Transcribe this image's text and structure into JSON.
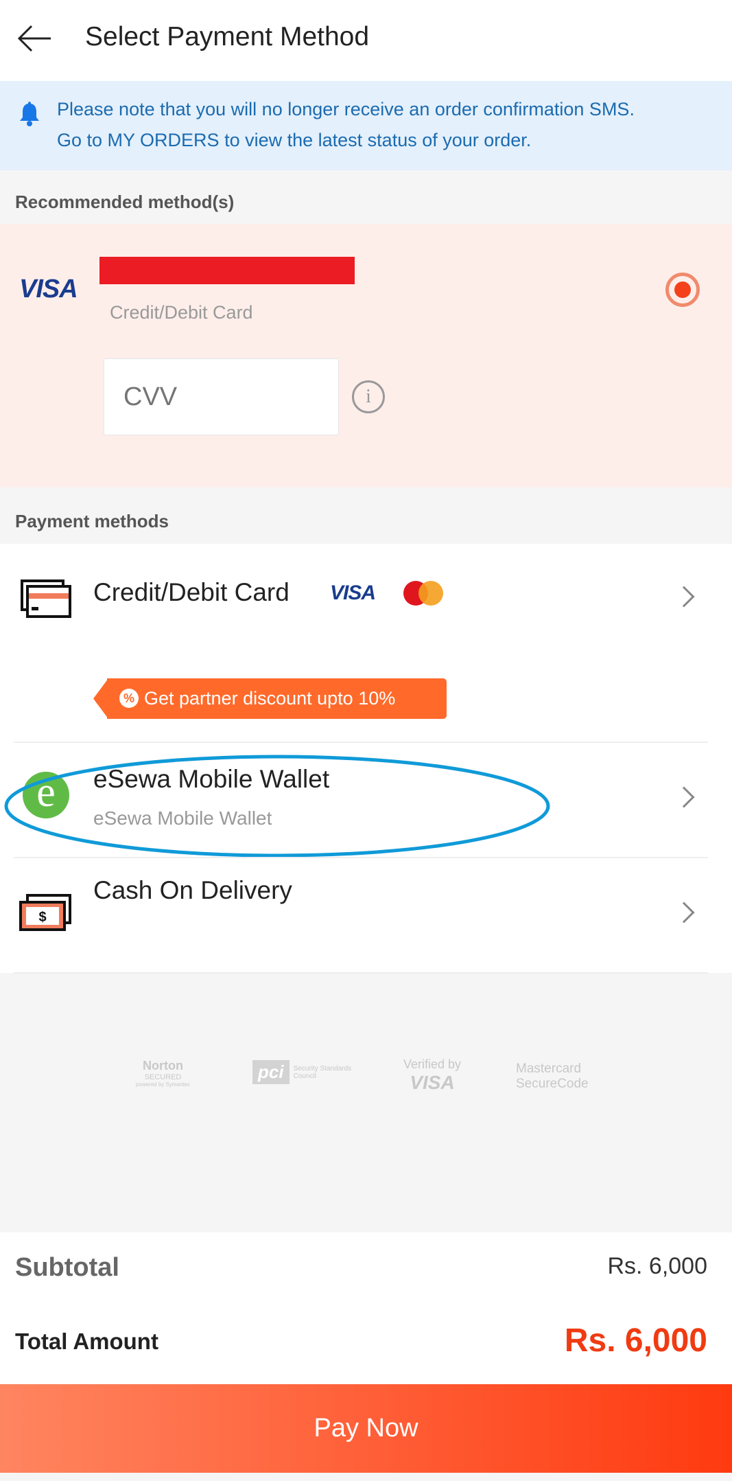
{
  "header": {
    "title": "Select Payment Method",
    "back_icon": "arrow-left-icon"
  },
  "notice": {
    "icon": "bell-icon",
    "line1": "Please note that you will no longer receive an order confirmation SMS.",
    "line2": "Go to MY ORDERS to view the latest status of your order.",
    "color": "#1b6bb0"
  },
  "recommended": {
    "heading": "Recommended method(s)",
    "card_brand": "VISA",
    "card_type": "Credit/Debit Card",
    "cvv_placeholder": "CVV",
    "selected": true,
    "info_icon": "info-icon"
  },
  "payment_methods": {
    "heading": "Payment methods",
    "items": [
      {
        "label": "Credit/Debit Card",
        "brand": "VISA",
        "icon": "credit-card-icon",
        "promo": "Get partner discount upto 10%"
      },
      {
        "label": "eSewa Mobile Wallet",
        "sublabel": "eSewa Mobile Wallet",
        "icon": "esewa-logo-icon"
      },
      {
        "label": "Cash On Delivery",
        "icon": "cash-icon"
      }
    ]
  },
  "security_logos": {
    "norton": "Norton",
    "norton_sub": "SECURED",
    "norton_by": "powered by Symantec",
    "pci": "pci",
    "pci_sub": "Security Standards Council",
    "visa_line1": "Verified by",
    "visa_line2": "VISA",
    "mc_line1": "Mastercard",
    "mc_line2": "SecureCode"
  },
  "summary": {
    "subtotal_label": "Subtotal",
    "subtotal_value": "Rs. 6,000",
    "total_label": "Total Amount",
    "total_value": "Rs. 6,000",
    "accent": "#f03b12"
  },
  "pay_button": "Pay Now"
}
